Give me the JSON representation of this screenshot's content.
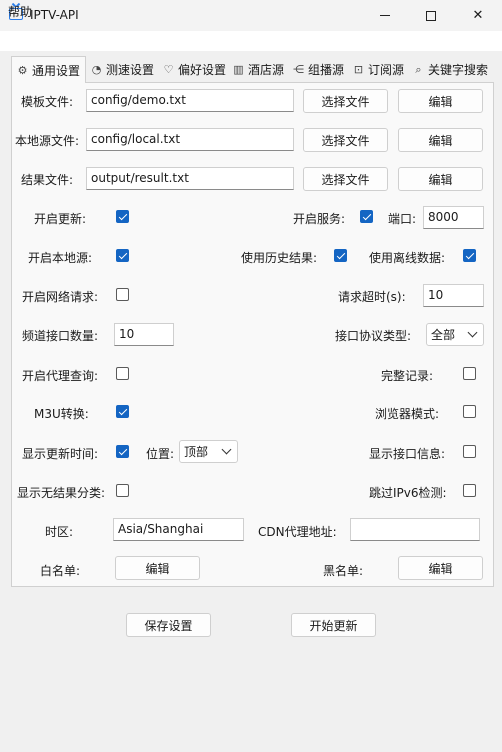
{
  "window": {
    "title": "IPTV-API"
  },
  "menu": {
    "help": "帮助"
  },
  "tabs": [
    {
      "label": "通用设置",
      "icon": "gear-icon"
    },
    {
      "label": "测速设置",
      "icon": "speedometer-icon"
    },
    {
      "label": "偏好设置",
      "icon": "heart-icon"
    },
    {
      "label": "酒店源",
      "icon": "hotel-icon"
    },
    {
      "label": "组播源",
      "icon": "multicast-icon"
    },
    {
      "label": "订阅源",
      "icon": "bookmark-icon"
    },
    {
      "label": "关键字搜索",
      "icon": "search-icon"
    }
  ],
  "files": {
    "template": {
      "label": "模板文件:",
      "value": "config/demo.txt"
    },
    "local": {
      "label": "本地源文件:",
      "value": "config/local.txt"
    },
    "result": {
      "label": "结果文件:",
      "value": "output/result.txt"
    },
    "select_label": "选择文件",
    "edit_label": "编辑"
  },
  "settings": {
    "open_update": {
      "label": "开启更新:",
      "checked": true
    },
    "open_service": {
      "label": "开启服务:",
      "checked": true
    },
    "port": {
      "label": "端口:",
      "value": "8000"
    },
    "open_local": {
      "label": "开启本地源:",
      "checked": true
    },
    "use_history": {
      "label": "使用历史结果:",
      "checked": true
    },
    "use_offline": {
      "label": "使用离线数据:",
      "checked": true
    },
    "open_network": {
      "label": "开启网络请求:",
      "checked": false
    },
    "request_timeout": {
      "label": "请求超时(s):",
      "value": "10"
    },
    "channel_count": {
      "label": "频道接口数量:",
      "value": "10"
    },
    "protocol_type": {
      "label": "接口协议类型:",
      "value": "全部"
    },
    "open_proxy": {
      "label": "开启代理查询:",
      "checked": false
    },
    "full_record": {
      "label": "完整记录:",
      "checked": false
    },
    "m3u": {
      "label": "M3U转换:",
      "checked": true
    },
    "browser_mode": {
      "label": "浏览器模式:",
      "checked": false
    },
    "show_update_time": {
      "label": "显示更新时间:",
      "checked": true
    },
    "position": {
      "label": "位置:",
      "value": "顶部"
    },
    "show_info": {
      "label": "显示接口信息:",
      "checked": false
    },
    "show_no_result": {
      "label": "显示无结果分类:",
      "checked": false
    },
    "skip_ipv6": {
      "label": "跳过IPv6检测:",
      "checked": false
    },
    "timezone": {
      "label": "时区:",
      "value": "Asia/Shanghai"
    },
    "cdn_proxy": {
      "label": "CDN代理地址:",
      "value": ""
    },
    "whitelist": {
      "label": "白名单:",
      "button": "编辑"
    },
    "blacklist": {
      "label": "黑名单:",
      "button": "编辑"
    }
  },
  "footer": {
    "save": "保存设置",
    "start": "开始更新"
  },
  "colors": {
    "accent": "#1465c3"
  }
}
